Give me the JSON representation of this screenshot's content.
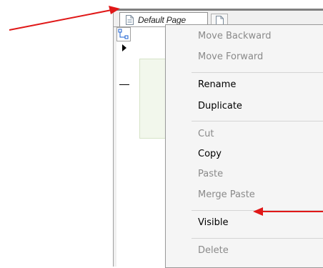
{
  "tabs": {
    "active_page": "Default Page"
  },
  "context_menu": {
    "items": [
      {
        "label": "Move Backward",
        "enabled": false
      },
      {
        "label": "Move Forward",
        "enabled": false
      },
      {
        "label": "Rename",
        "enabled": true
      },
      {
        "label": "Duplicate",
        "enabled": true
      },
      {
        "label": "Cut",
        "enabled": false
      },
      {
        "label": "Copy",
        "enabled": true
      },
      {
        "label": "Paste",
        "enabled": false
      },
      {
        "label": "Merge Paste",
        "enabled": false
      },
      {
        "label": "Visible",
        "enabled": true
      },
      {
        "label": "Delete",
        "enabled": false
      }
    ]
  },
  "annotations": {
    "arrow_color": "#e01818"
  },
  "icons": [
    "page-icon",
    "new-page-icon",
    "ruler-origin-icon"
  ]
}
